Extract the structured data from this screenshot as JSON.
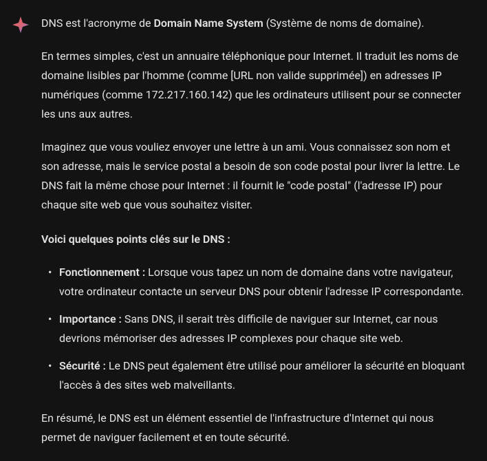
{
  "message": {
    "intro": {
      "prefix": "DNS est l'acronyme de ",
      "bold": "Domain Name System",
      "suffix": " (Système de noms de domaine)."
    },
    "para1": "En termes simples, c'est un annuaire téléphonique pour Internet. Il traduit les noms de domaine lisibles par l'homme (comme [URL non valide supprimée]) en adresses IP numériques (comme 172.217.160.142) que les ordinateurs utilisent pour se connecter les uns aux autres.",
    "para2": "Imaginez que vous vouliez envoyer une lettre à un ami. Vous connaissez son nom et son adresse, mais le service postal a besoin de son code postal pour livrer la lettre. Le DNS fait la même chose pour Internet : il fournit le \"code postal\" (l'adresse IP) pour chaque site web que vous souhaitez visiter.",
    "heading": "Voici quelques points clés sur le DNS :",
    "bullets": [
      {
        "label": "Fonctionnement :",
        "text": " Lorsque vous tapez un nom de domaine dans votre navigateur, votre ordinateur contacte un serveur DNS pour obtenir l'adresse IP correspondante."
      },
      {
        "label": "Importance :",
        "text": " Sans DNS, il serait très difficile de naviguer sur Internet, car nous devrions mémoriser des adresses IP complexes pour chaque site web."
      },
      {
        "label": "Sécurité :",
        "text": " Le DNS peut également être utilisé pour améliorer la sécurité en bloquant l'accès à des sites web malveillants."
      }
    ],
    "summary": "En résumé, le DNS est un élément essentiel de l'infrastructure d'Internet qui nous permet de naviguer facilement et en toute sécurité."
  }
}
